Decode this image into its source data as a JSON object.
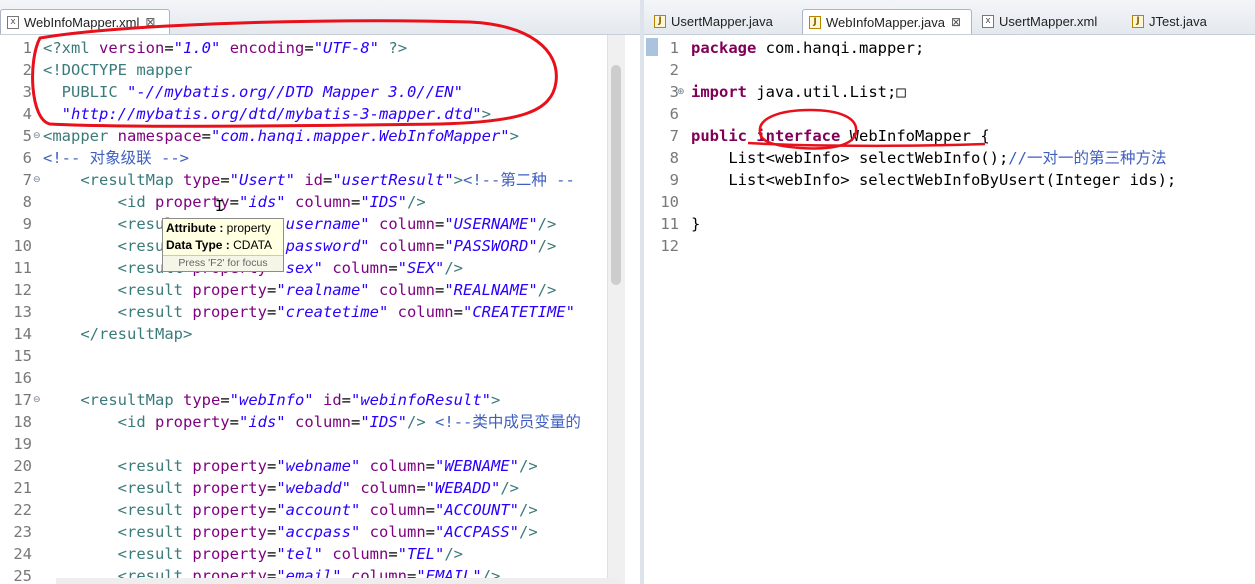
{
  "left": {
    "tabs": [
      {
        "label": "WebInfoMapper.xml",
        "icon": "xml-file-icon",
        "active": true,
        "close": "⊠"
      }
    ],
    "tooltip": {
      "attribute_label": "Attribute :",
      "attribute_value": "property",
      "datatype_label": "Data Type :",
      "datatype_value": "CDATA",
      "hint": "Press 'F2' for focus"
    }
  },
  "right": {
    "tabs": [
      {
        "label": "UsertMapper.java",
        "icon": "java-file-icon",
        "active": false
      },
      {
        "label": "WebInfoMapper.java",
        "icon": "java-file-icon",
        "active": true,
        "close": "⊠"
      },
      {
        "label": "UsertMapper.xml",
        "icon": "xml-file-icon",
        "active": false
      },
      {
        "label": "JTest.java",
        "icon": "java-file-icon",
        "active": false
      }
    ]
  },
  "xml_lines": [
    {
      "n": "1",
      "segs": [
        [
          "pi",
          "<?xml "
        ],
        [
          "aname",
          "version"
        ],
        [
          "plain",
          "="
        ],
        [
          "aval",
          "\"1.0\""
        ],
        [
          "plain",
          " "
        ],
        [
          "aname",
          "encoding"
        ],
        [
          "plain",
          "="
        ],
        [
          "aval",
          "\"UTF-8\""
        ],
        [
          "plain",
          " "
        ],
        [
          "pi",
          "?>"
        ]
      ]
    },
    {
      "n": "2",
      "segs": [
        [
          "tag",
          "<!DOCTYPE mapper"
        ]
      ]
    },
    {
      "n": "3",
      "segs": [
        [
          "tag",
          "  PUBLIC "
        ],
        [
          "aval",
          "\"-//mybatis.org//DTD Mapper 3.0//EN\""
        ]
      ]
    },
    {
      "n": "4",
      "segs": [
        [
          "aval",
          "  \"http://mybatis.org/dtd/mybatis-3-mapper.dtd\""
        ],
        [
          "tag",
          ">"
        ]
      ]
    },
    {
      "n": "5",
      "fold": "⊖",
      "segs": [
        [
          "tag",
          "<mapper "
        ],
        [
          "aname",
          "namespace"
        ],
        [
          "plain",
          "="
        ],
        [
          "aval",
          "\"com.hanqi.mapper.WebInfoMapper\""
        ],
        [
          "tag",
          ">"
        ]
      ]
    },
    {
      "n": "6",
      "segs": [
        [
          "cm",
          "<!-- 对象级联 -->"
        ]
      ]
    },
    {
      "n": "7",
      "fold": "⊖",
      "segs": [
        [
          "tag",
          "    <resultMap "
        ],
        [
          "aname",
          "type"
        ],
        [
          "plain",
          "="
        ],
        [
          "aval",
          "\"Usert\""
        ],
        [
          "plain",
          " "
        ],
        [
          "aname",
          "id"
        ],
        [
          "plain",
          "="
        ],
        [
          "aval",
          "\"usertResult\""
        ],
        [
          "tag",
          ">"
        ],
        [
          "cm",
          "<!--第二种 --"
        ]
      ]
    },
    {
      "n": "8",
      "segs": [
        [
          "tag",
          "        <id "
        ],
        [
          "aname",
          "property"
        ],
        [
          "plain",
          "="
        ],
        [
          "aval",
          "\"ids\""
        ],
        [
          "plain",
          " "
        ],
        [
          "aname",
          "column"
        ],
        [
          "plain",
          "="
        ],
        [
          "aval",
          "\"IDS\""
        ],
        [
          "tag",
          "/>"
        ]
      ]
    },
    {
      "n": "9",
      "segs": [
        [
          "tag",
          "        <result "
        ],
        [
          "aname",
          "property"
        ],
        [
          "plain",
          "="
        ],
        [
          "aval",
          "\"username\""
        ],
        [
          "plain",
          " "
        ],
        [
          "aname",
          "column"
        ],
        [
          "plain",
          "="
        ],
        [
          "aval",
          "\"USERNAME\""
        ],
        [
          "tag",
          "/>"
        ]
      ]
    },
    {
      "n": "10",
      "segs": [
        [
          "tag",
          "        <result "
        ],
        [
          "aname",
          "property"
        ],
        [
          "plain",
          "="
        ],
        [
          "aval",
          "\"password\""
        ],
        [
          "plain",
          " "
        ],
        [
          "aname",
          "column"
        ],
        [
          "plain",
          "="
        ],
        [
          "aval",
          "\"PASSWORD\""
        ],
        [
          "tag",
          "/>"
        ]
      ]
    },
    {
      "n": "11",
      "segs": [
        [
          "tag",
          "        <result "
        ],
        [
          "aname",
          "property"
        ],
        [
          "plain",
          "="
        ],
        [
          "aval",
          "\"sex\""
        ],
        [
          "plain",
          " "
        ],
        [
          "aname",
          "column"
        ],
        [
          "plain",
          "="
        ],
        [
          "aval",
          "\"SEX\""
        ],
        [
          "tag",
          "/>"
        ]
      ]
    },
    {
      "n": "12",
      "segs": [
        [
          "tag",
          "        <result "
        ],
        [
          "aname",
          "property"
        ],
        [
          "plain",
          "="
        ],
        [
          "aval",
          "\"realname\""
        ],
        [
          "plain",
          " "
        ],
        [
          "aname",
          "column"
        ],
        [
          "plain",
          "="
        ],
        [
          "aval",
          "\"REALNAME\""
        ],
        [
          "tag",
          "/>"
        ]
      ]
    },
    {
      "n": "13",
      "segs": [
        [
          "tag",
          "        <result "
        ],
        [
          "aname",
          "property"
        ],
        [
          "plain",
          "="
        ],
        [
          "aval",
          "\"createtime\""
        ],
        [
          "plain",
          " "
        ],
        [
          "aname",
          "column"
        ],
        [
          "plain",
          "="
        ],
        [
          "aval",
          "\"CREATETIME\""
        ]
      ]
    },
    {
      "n": "14",
      "segs": [
        [
          "tag",
          "    </resultMap>"
        ]
      ]
    },
    {
      "n": "15",
      "segs": []
    },
    {
      "n": "16",
      "segs": []
    },
    {
      "n": "17",
      "fold": "⊖",
      "segs": [
        [
          "tag",
          "    <resultMap "
        ],
        [
          "aname",
          "type"
        ],
        [
          "plain",
          "="
        ],
        [
          "aval",
          "\"webInfo\""
        ],
        [
          "plain",
          " "
        ],
        [
          "aname",
          "id"
        ],
        [
          "plain",
          "="
        ],
        [
          "aval",
          "\"webinfoResult\""
        ],
        [
          "tag",
          ">"
        ]
      ]
    },
    {
      "n": "18",
      "segs": [
        [
          "tag",
          "        <id "
        ],
        [
          "aname",
          "property"
        ],
        [
          "plain",
          "="
        ],
        [
          "aval",
          "\"ids\""
        ],
        [
          "plain",
          " "
        ],
        [
          "aname",
          "column"
        ],
        [
          "plain",
          "="
        ],
        [
          "aval",
          "\"IDS\""
        ],
        [
          "tag",
          "/>"
        ],
        [
          "plain",
          " "
        ],
        [
          "cm",
          "<!--类中成员变量的"
        ]
      ]
    },
    {
      "n": "19",
      "segs": []
    },
    {
      "n": "20",
      "segs": [
        [
          "tag",
          "        <result "
        ],
        [
          "aname",
          "property"
        ],
        [
          "plain",
          "="
        ],
        [
          "aval",
          "\"webname\""
        ],
        [
          "plain",
          " "
        ],
        [
          "aname",
          "column"
        ],
        [
          "plain",
          "="
        ],
        [
          "aval",
          "\"WEBNAME\""
        ],
        [
          "tag",
          "/>"
        ]
      ]
    },
    {
      "n": "21",
      "segs": [
        [
          "tag",
          "        <result "
        ],
        [
          "aname",
          "property"
        ],
        [
          "plain",
          "="
        ],
        [
          "aval",
          "\"webadd\""
        ],
        [
          "plain",
          " "
        ],
        [
          "aname",
          "column"
        ],
        [
          "plain",
          "="
        ],
        [
          "aval",
          "\"WEBADD\""
        ],
        [
          "tag",
          "/>"
        ]
      ]
    },
    {
      "n": "22",
      "segs": [
        [
          "tag",
          "        <result "
        ],
        [
          "aname",
          "property"
        ],
        [
          "plain",
          "="
        ],
        [
          "aval",
          "\"account\""
        ],
        [
          "plain",
          " "
        ],
        [
          "aname",
          "column"
        ],
        [
          "plain",
          "="
        ],
        [
          "aval",
          "\"ACCOUNT\""
        ],
        [
          "tag",
          "/>"
        ]
      ]
    },
    {
      "n": "23",
      "segs": [
        [
          "tag",
          "        <result "
        ],
        [
          "aname",
          "property"
        ],
        [
          "plain",
          "="
        ],
        [
          "aval",
          "\"accpass\""
        ],
        [
          "plain",
          " "
        ],
        [
          "aname",
          "column"
        ],
        [
          "plain",
          "="
        ],
        [
          "aval",
          "\"ACCPASS\""
        ],
        [
          "tag",
          "/>"
        ]
      ]
    },
    {
      "n": "24",
      "segs": [
        [
          "tag",
          "        <result "
        ],
        [
          "aname",
          "property"
        ],
        [
          "plain",
          "="
        ],
        [
          "aval",
          "\"tel\""
        ],
        [
          "plain",
          " "
        ],
        [
          "aname",
          "column"
        ],
        [
          "plain",
          "="
        ],
        [
          "aval",
          "\"TEL\""
        ],
        [
          "tag",
          "/>"
        ]
      ]
    },
    {
      "n": "25",
      "segs": [
        [
          "tag",
          "        <result "
        ],
        [
          "aname",
          "property"
        ],
        [
          "plain",
          "="
        ],
        [
          "aval",
          "\"email\""
        ],
        [
          "plain",
          " "
        ],
        [
          "aname",
          "column"
        ],
        [
          "plain",
          "="
        ],
        [
          "aval",
          "\"EMAIL\""
        ],
        [
          "tag",
          "/>"
        ]
      ]
    }
  ],
  "java_lines": [
    {
      "n": "1",
      "segs": [
        [
          "kw",
          "package"
        ],
        [
          "plain",
          " com.hanqi.mapper;"
        ]
      ]
    },
    {
      "n": "2",
      "segs": []
    },
    {
      "n": "3",
      "fold": "⊕",
      "segs": [
        [
          "kw",
          "import"
        ],
        [
          "plain",
          " java.util.List;"
        ],
        [
          "plain",
          "□"
        ]
      ]
    },
    {
      "n": "6",
      "segs": []
    },
    {
      "n": "7",
      "segs": [
        [
          "kw",
          "public"
        ],
        [
          "plain",
          " "
        ],
        [
          "kw",
          "interface"
        ],
        [
          "plain",
          " WebInfoMapper {"
        ]
      ]
    },
    {
      "n": "8",
      "segs": [
        [
          "plain",
          "    List<webInfo> selectWebInfo();"
        ],
        [
          "cm",
          "//一对一的第三种方法"
        ]
      ]
    },
    {
      "n": "9",
      "segs": [
        [
          "plain",
          "    List<webInfo> selectWebInfoByUsert(Integer ids);"
        ]
      ]
    },
    {
      "n": "10",
      "segs": []
    },
    {
      "n": "11",
      "segs": [
        [
          "plain",
          "}"
        ]
      ]
    },
    {
      "n": "12",
      "segs": []
    }
  ],
  "colors": {
    "annotation_red": "#e8101a",
    "tag": "#3a7a7a",
    "attr_name": "#7f007f",
    "attr_value": "#2a00ff",
    "comment": "#3f5fbf",
    "keyword": "#7f0055"
  }
}
